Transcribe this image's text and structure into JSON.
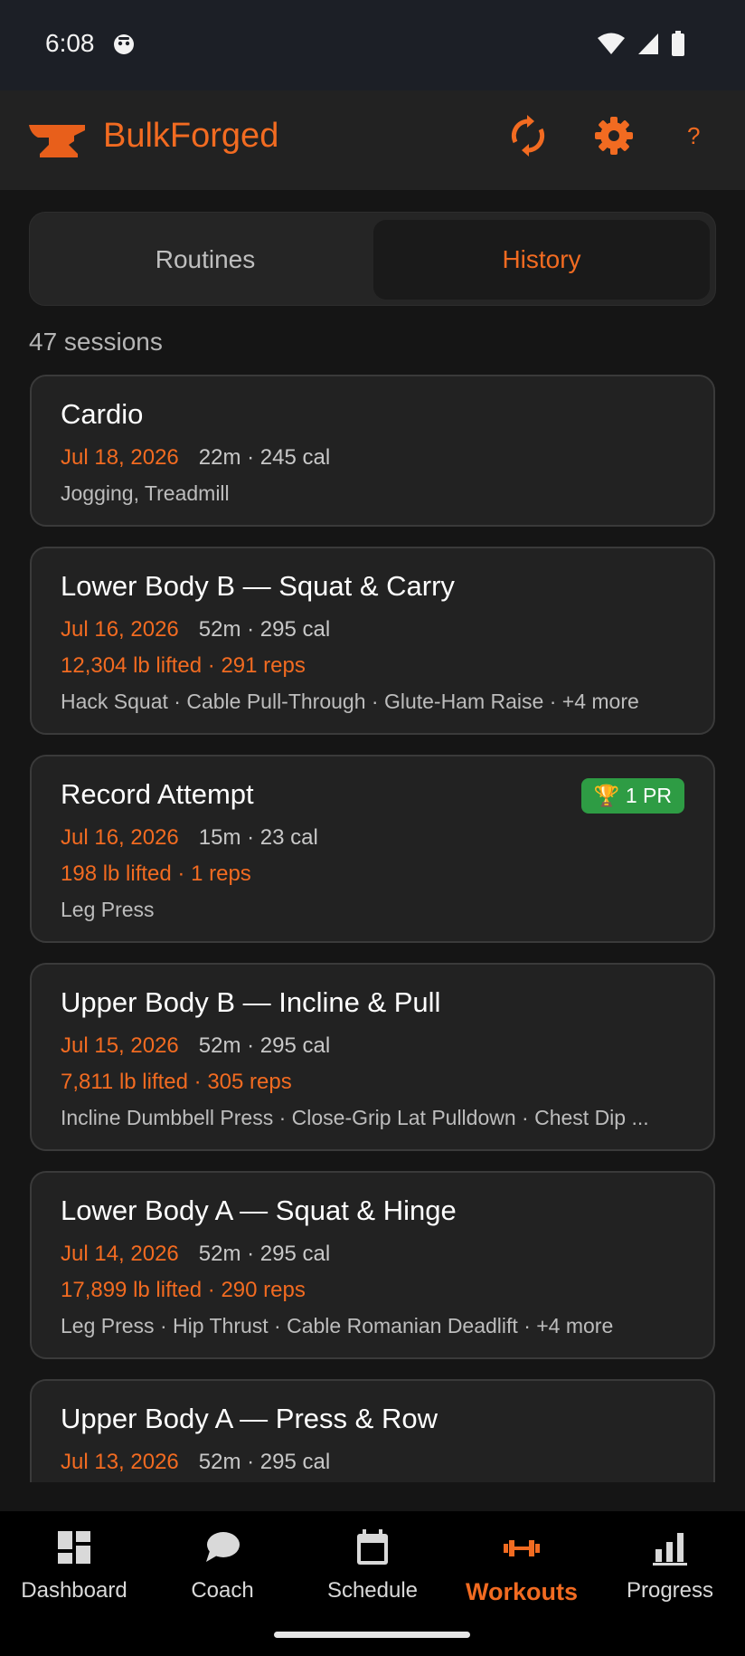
{
  "status_bar": {
    "time": "6:08"
  },
  "app": {
    "title": "BulkForged",
    "help_label": "?"
  },
  "colors": {
    "accent": "#f26b21",
    "pr_badge": "#2e9c44",
    "background": "#151515",
    "card": "#222222"
  },
  "tabs": {
    "routines": "Routines",
    "history": "History",
    "active": "History"
  },
  "sessions_count": "47 sessions",
  "sessions": [
    {
      "title": "Cardio",
      "date": "Jul 18, 2026",
      "stats": "22m · 245 cal",
      "lifted": "",
      "exercises": "Jogging, Treadmill",
      "badge": ""
    },
    {
      "title": "Lower Body B — Squat & Carry",
      "date": "Jul 16, 2026",
      "stats": "52m · 295 cal",
      "lifted": "12,304 lb lifted · 291 reps",
      "exercises": "Hack Squat · Cable Pull-Through · Glute-Ham Raise · +4 more",
      "badge": ""
    },
    {
      "title": "Record Attempt",
      "date": "Jul 16, 2026",
      "stats": "15m · 23 cal",
      "lifted": "198 lb lifted · 1 reps",
      "exercises": "Leg Press",
      "badge": "🏆 1 PR"
    },
    {
      "title": "Upper Body B — Incline & Pull",
      "date": "Jul 15, 2026",
      "stats": "52m · 295 cal",
      "lifted": "7,811 lb lifted · 305 reps",
      "exercises": "Incline Dumbbell Press · Close-Grip Lat Pulldown · Chest Dip ...",
      "badge": ""
    },
    {
      "title": "Lower Body A — Squat & Hinge",
      "date": "Jul 14, 2026",
      "stats": "52m · 295 cal",
      "lifted": "17,899 lb lifted · 290 reps",
      "exercises": "Leg Press · Hip Thrust · Cable Romanian Deadlift · +4 more",
      "badge": ""
    },
    {
      "title": "Upper Body A — Press & Row",
      "date": "Jul 13, 2026",
      "stats": "52m · 295 cal",
      "lifted": "",
      "exercises": "",
      "badge": ""
    }
  ],
  "bottom_nav": [
    {
      "label": "Dashboard",
      "icon": "dashboard-icon"
    },
    {
      "label": "Coach",
      "icon": "chat-bubble-icon"
    },
    {
      "label": "Schedule",
      "icon": "calendar-icon"
    },
    {
      "label": "Workouts",
      "icon": "dumbbell-icon",
      "active": true
    },
    {
      "label": "Progress",
      "icon": "bar-chart-icon"
    }
  ]
}
